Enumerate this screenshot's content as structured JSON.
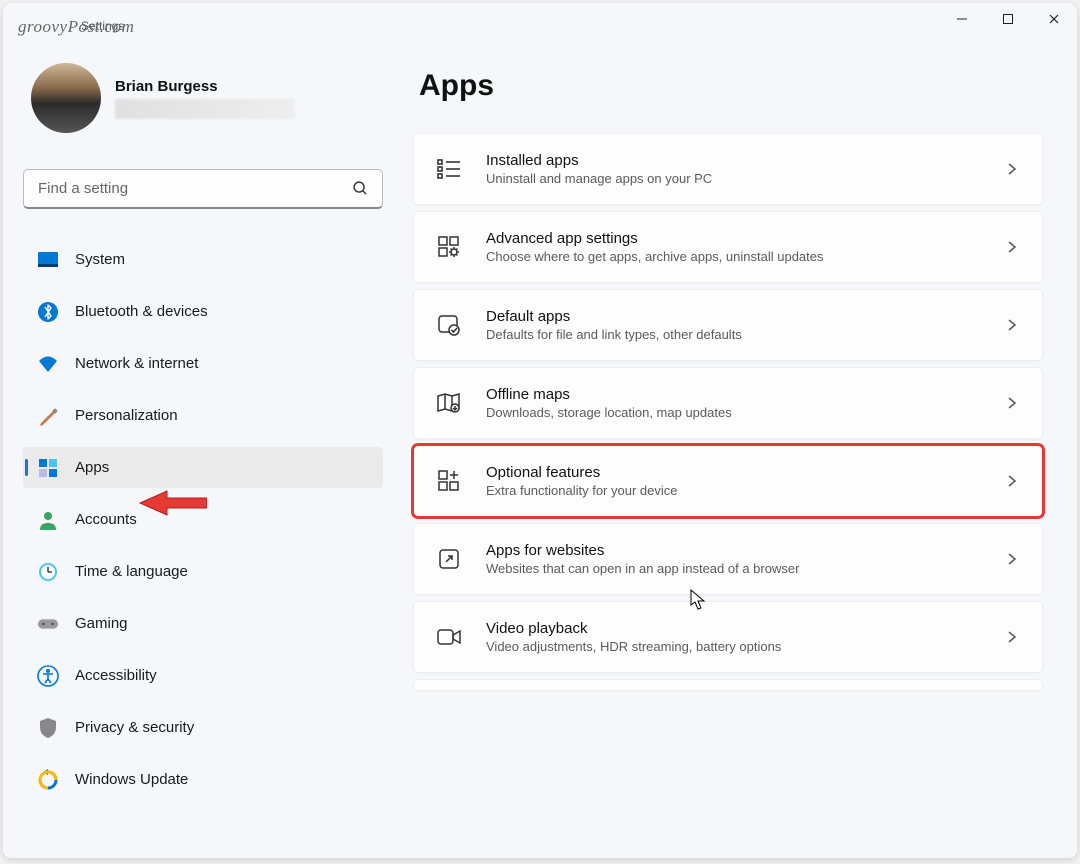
{
  "watermark": "groovyPost.com",
  "titlebar": {
    "title": "Settings"
  },
  "profile": {
    "name": "Brian Burgess"
  },
  "search": {
    "placeholder": "Find a setting"
  },
  "sidebar": {
    "items": [
      {
        "label": "System"
      },
      {
        "label": "Bluetooth & devices"
      },
      {
        "label": "Network & internet"
      },
      {
        "label": "Personalization"
      },
      {
        "label": "Apps"
      },
      {
        "label": "Accounts"
      },
      {
        "label": "Time & language"
      },
      {
        "label": "Gaming"
      },
      {
        "label": "Accessibility"
      },
      {
        "label": "Privacy & security"
      },
      {
        "label": "Windows Update"
      }
    ]
  },
  "page": {
    "title": "Apps"
  },
  "cards": [
    {
      "title": "Installed apps",
      "sub": "Uninstall and manage apps on your PC"
    },
    {
      "title": "Advanced app settings",
      "sub": "Choose where to get apps, archive apps, uninstall updates"
    },
    {
      "title": "Default apps",
      "sub": "Defaults for file and link types, other defaults"
    },
    {
      "title": "Offline maps",
      "sub": "Downloads, storage location, map updates"
    },
    {
      "title": "Optional features",
      "sub": "Extra functionality for your device"
    },
    {
      "title": "Apps for websites",
      "sub": "Websites that can open in an app instead of a browser"
    },
    {
      "title": "Video playback",
      "sub": "Video adjustments, HDR streaming, battery options"
    }
  ]
}
